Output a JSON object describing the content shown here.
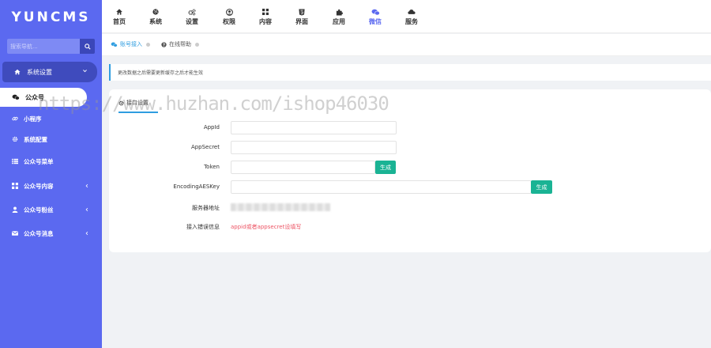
{
  "app": {
    "logo": "YUNCMS"
  },
  "sidebar": {
    "search_placeholder": "搜索导航...",
    "group": {
      "label": "系统设置"
    },
    "active_item": {
      "label": "公众号"
    },
    "items": [
      {
        "label": "小程序",
        "icon": "link-icon"
      },
      {
        "label": "系统配置",
        "icon": "gear-icon"
      },
      {
        "label": "公众号菜单",
        "icon": "list-icon"
      },
      {
        "label": "公众号内容",
        "icon": "grid-icon"
      },
      {
        "label": "公众号粉丝",
        "icon": "user-icon"
      },
      {
        "label": "公众号消息",
        "icon": "mail-icon"
      }
    ]
  },
  "topnav": [
    {
      "label": "首页",
      "icon": "home-icon"
    },
    {
      "label": "系统",
      "icon": "globe-icon"
    },
    {
      "label": "设置",
      "icon": "gears-icon"
    },
    {
      "label": "权限",
      "icon": "user-circle-icon"
    },
    {
      "label": "内容",
      "icon": "grid-icon"
    },
    {
      "label": "界面",
      "icon": "html5-icon"
    },
    {
      "label": "应用",
      "icon": "puzzle-icon"
    },
    {
      "label": "微信",
      "icon": "wechat-icon"
    },
    {
      "label": "服务",
      "icon": "cloud-icon"
    }
  ],
  "tabs": [
    {
      "label": "账号接入"
    },
    {
      "label": "在线帮助"
    }
  ],
  "notice": "更改数据之后需要更新缓存之后才能生效",
  "card": {
    "tab_label": "接口设置",
    "fields": {
      "appid_label": "AppId",
      "appsecret_label": "AppSecret",
      "token_label": "Token",
      "aeskey_label": "EncodingAESKey",
      "server_label": "服务器地址",
      "error_label": "接入错误信息"
    },
    "generate_label": "生成",
    "error_text": "appid或者appsecret设填写"
  },
  "watermark": "https://www.huzhan.com/ishop46030",
  "colors": {
    "sidebar": "#5b69f0",
    "accent": "#2f9de0",
    "button": "#1ab394",
    "error": "#ed5565"
  }
}
